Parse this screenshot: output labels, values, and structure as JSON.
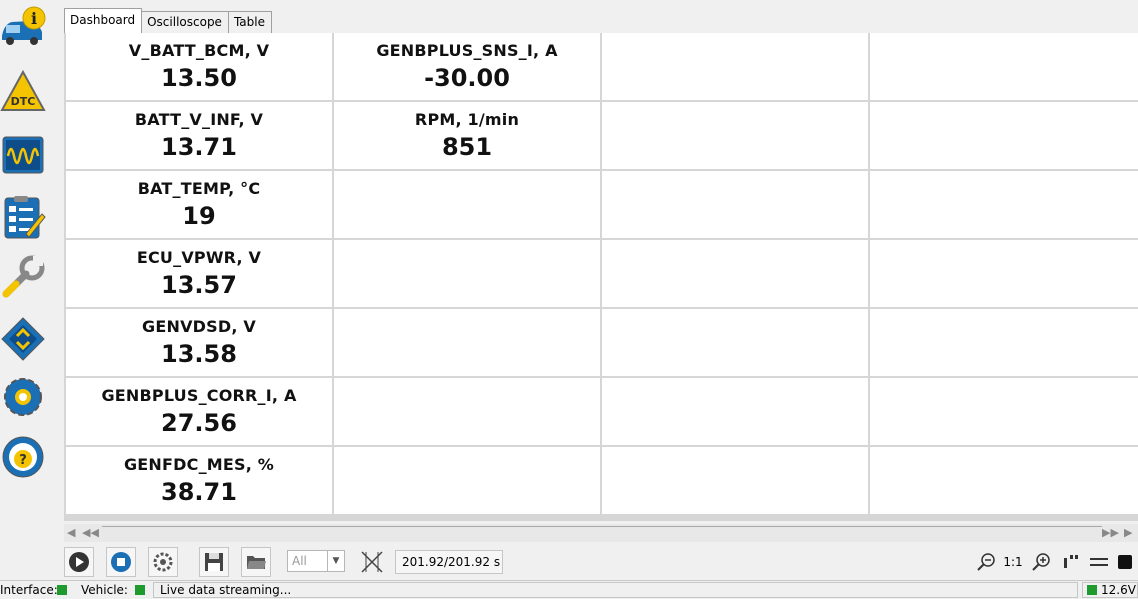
{
  "sidebar": {
    "items": [
      {
        "icon": "vehicle-info-icon"
      },
      {
        "icon": "dtc-warning-icon",
        "label": "DTC"
      },
      {
        "icon": "oscilloscope-icon"
      },
      {
        "icon": "checklist-icon"
      },
      {
        "icon": "wrench-icon"
      },
      {
        "icon": "chip-icon"
      },
      {
        "icon": "gear-icon"
      },
      {
        "icon": "steering-help-icon"
      }
    ]
  },
  "tabs": [
    {
      "label": "Dashboard",
      "active": true
    },
    {
      "label": "Oscilloscope",
      "active": false
    },
    {
      "label": "Table",
      "active": false
    }
  ],
  "grid": {
    "cells": [
      {
        "name": "V_BATT_BCM, V",
        "value": "13.50"
      },
      {
        "name": "GENBPLUS_SNS_I, A",
        "value": "-30.00"
      },
      {
        "name": "",
        "value": ""
      },
      {
        "name": "",
        "value": ""
      },
      {
        "name": "BATT_V_INF, V",
        "value": "13.71"
      },
      {
        "name": "RPM, 1/min",
        "value": "851"
      },
      {
        "name": "",
        "value": ""
      },
      {
        "name": "",
        "value": ""
      },
      {
        "name": "BAT_TEMP, °C",
        "value": "19"
      },
      {
        "name": "",
        "value": ""
      },
      {
        "name": "",
        "value": ""
      },
      {
        "name": "",
        "value": ""
      },
      {
        "name": "ECU_VPWR, V",
        "value": "13.57"
      },
      {
        "name": "",
        "value": ""
      },
      {
        "name": "",
        "value": ""
      },
      {
        "name": "",
        "value": ""
      },
      {
        "name": "GENVDSD, V",
        "value": "13.58"
      },
      {
        "name": "",
        "value": ""
      },
      {
        "name": "",
        "value": ""
      },
      {
        "name": "",
        "value": ""
      },
      {
        "name": "GENBPLUS_CORR_I, A",
        "value": "27.56"
      },
      {
        "name": "",
        "value": ""
      },
      {
        "name": "",
        "value": ""
      },
      {
        "name": "",
        "value": ""
      },
      {
        "name": "GENFDC_MES, %",
        "value": "38.71"
      },
      {
        "name": "",
        "value": ""
      },
      {
        "name": "",
        "value": ""
      },
      {
        "name": "",
        "value": ""
      }
    ]
  },
  "toolbar": {
    "filter_value": "All",
    "time_display": "201.92/201.92 s",
    "zoom_ratio": "1:1"
  },
  "status": {
    "interface_label": "Interface:",
    "vehicle_label": "Vehicle:",
    "message": "Live data streaming...",
    "voltage": "12.6V"
  },
  "colors": {
    "status_ok": "#1f9b2d",
    "accent_blue": "#1a6fb5",
    "warning_yellow": "#f5c400"
  }
}
